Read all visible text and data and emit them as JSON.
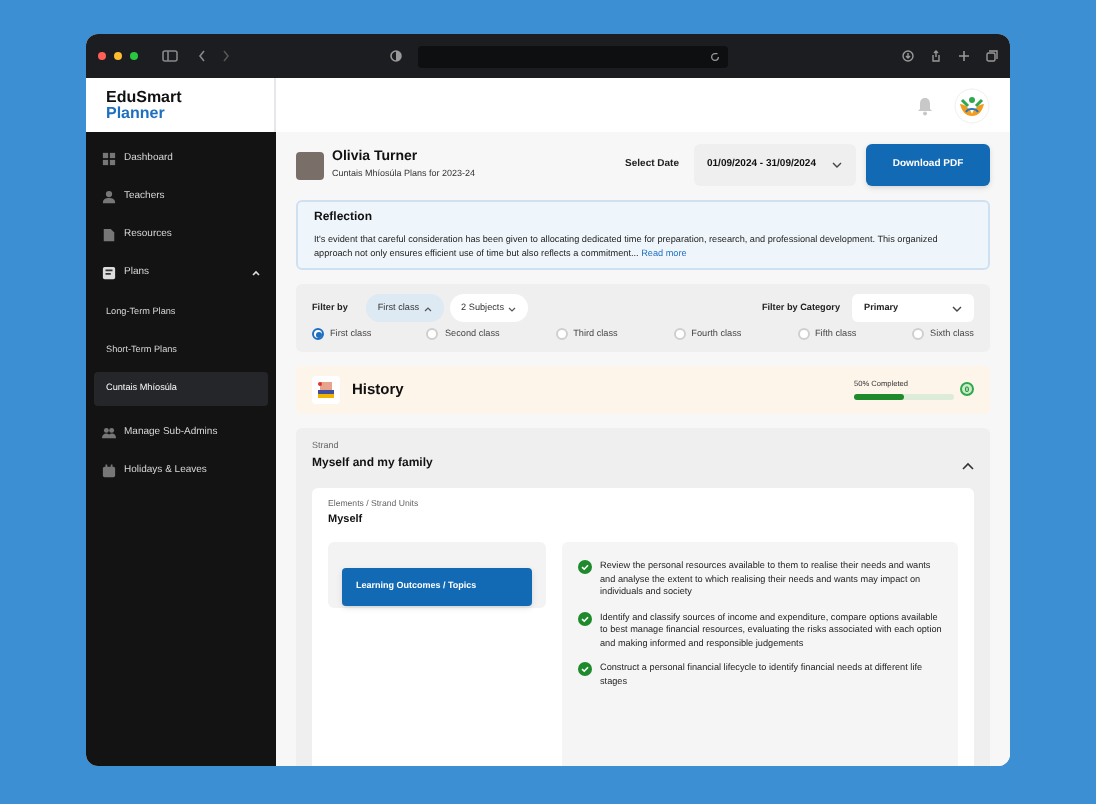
{
  "app": {
    "logo_line1": "EduSmart",
    "logo_line2": "Planner"
  },
  "sidebar": {
    "items": [
      {
        "label": "Dashboard",
        "kind": "dashboard",
        "selected": false
      },
      {
        "label": "Teachers",
        "kind": "person",
        "selected": false
      },
      {
        "label": "Resources",
        "kind": "file",
        "selected": false
      },
      {
        "label": "Plans",
        "kind": "plans",
        "selected": false,
        "expanded": true,
        "children": [
          {
            "label": "Long-Term Plans",
            "selected": false
          },
          {
            "label": "Short-Term Plans",
            "selected": false
          },
          {
            "label": "Cuntais Mhíosúla",
            "selected": true
          }
        ]
      },
      {
        "label": "Manage Sub-Admins",
        "kind": "people",
        "selected": false
      },
      {
        "label": "Holidays & Leaves",
        "kind": "calendar",
        "selected": false
      }
    ]
  },
  "profile": {
    "name": "Olivia Turner",
    "subtitle": "Cuntais Mhíosúla Plans for 2023-24",
    "date_label": "Select Date",
    "date_value": "01/09/2024 - 31/09/2024",
    "download_button": "Download PDF"
  },
  "reflection": {
    "title": "Reflection",
    "text": "It's evident that careful consideration has been given to allocating dedicated time for preparation, research, and professional development. This organized approach not only ensures efficient use of time but also reflects a commitment...",
    "link": "Read more"
  },
  "filters": {
    "filter_label": "Filter by",
    "chips": [
      "First class",
      "2 Subjects"
    ],
    "category_label": "Filter by Category",
    "category_value": "Primary",
    "classes": [
      {
        "label": "First class",
        "selected": true
      },
      {
        "label": "Second class",
        "selected": false
      },
      {
        "label": "Third class",
        "selected": false
      },
      {
        "label": "Fourth class",
        "selected": false
      },
      {
        "label": "Fifth class",
        "selected": false
      },
      {
        "label": "Sixth class",
        "selected": false
      }
    ]
  },
  "subject": {
    "title": "History",
    "progress_label": "50% Completed",
    "level": 0.5,
    "count": "0"
  },
  "strand": {
    "label": "Strand",
    "title": "Myself and my family",
    "expanded": true,
    "unit_label": "Elements / Strand Units",
    "unit_title": "Myself",
    "outcomes_button": "Learning Outcomes / Topics",
    "outcomes": [
      {
        "text": "Review the personal resources available to them to realise their needs and wants and analyse the extent to which realising their needs and wants may impact on individuals and society",
        "checked": true
      },
      {
        "text": "Identify and classify sources of income and expenditure, compare options available to best manage financial resources, evaluating the risks associated with each option and making informed and responsible judgements",
        "checked": true
      },
      {
        "text": "Construct a personal financial lifecycle to identify financial needs at different life stages",
        "checked": true
      }
    ]
  }
}
